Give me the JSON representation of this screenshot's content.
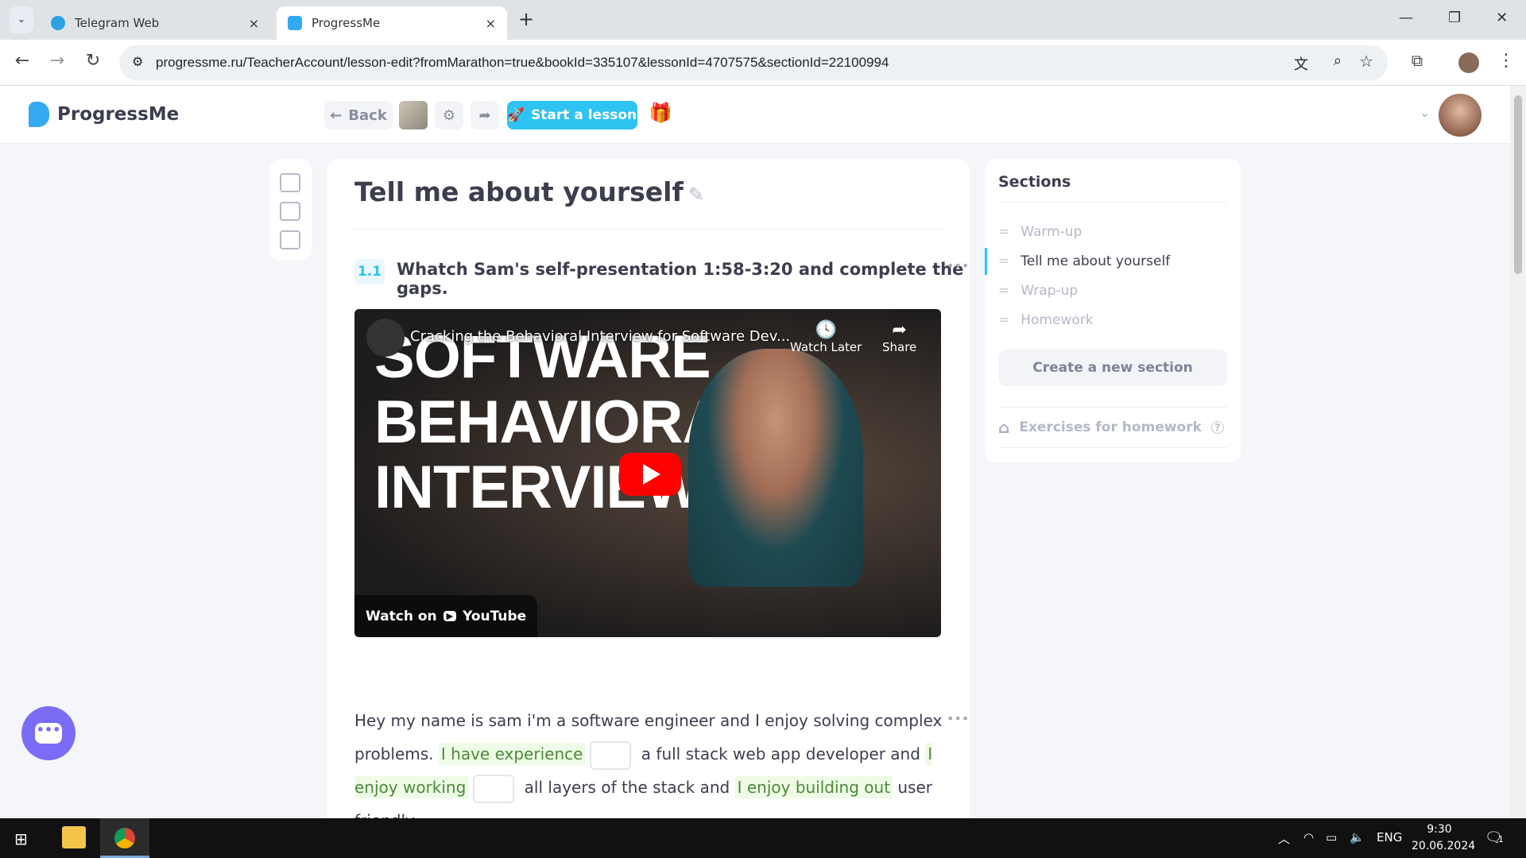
{
  "browser": {
    "tabs": [
      {
        "label": "Telegram Web",
        "close": "×"
      },
      {
        "label": "ProgressMe",
        "close": "×"
      }
    ],
    "new_tab": "+",
    "url": "progressme.ru/TeacherAccount/lesson-edit?fromMarathon=true&bookId=335107&lessonId=4707575&sectionId=22100994"
  },
  "header": {
    "logo": "ProgressMe",
    "back": "Back",
    "start_lesson": "Start a lesson"
  },
  "lesson": {
    "title": "Tell me about yourself",
    "exercise_number": "1.1",
    "exercise_title": "Whatch Sam's self-presentation 1:58-3:20 and complete the gaps.",
    "video": {
      "title": "Cracking the Behavioral Interview for Software Dev...",
      "thumbnail_text": "SOFTWARE BEHAVIORAL INTERVIEW",
      "watch_later": "Watch Later",
      "share": "Share",
      "watch_on": "Watch on",
      "youtube": "YouTube"
    },
    "text": {
      "p1": "Hey my name is sam i'm a software engineer and I enjoy solving complex problems. ",
      "h1": "I have experience",
      "p2": " a full stack web app developer and ",
      "h2": "I enjoy working",
      "p3": " all layers of the stack and ",
      "h3": "I enjoy building out",
      "p4": " user friendly"
    }
  },
  "sections": {
    "heading": "Sections",
    "items": [
      {
        "label": "Warm-up"
      },
      {
        "label": "Tell me about yourself",
        "active": true
      },
      {
        "label": "Wrap-up"
      },
      {
        "label": "Homework"
      }
    ],
    "create": "Create a new section",
    "homework": "Exercises for homework"
  },
  "taskbar": {
    "lang": "ENG",
    "time": "9:30",
    "date": "20.06.2024",
    "notifications": "1"
  },
  "colors": {
    "accent": "#2ec3f0",
    "chat": "#7b6cf6"
  }
}
